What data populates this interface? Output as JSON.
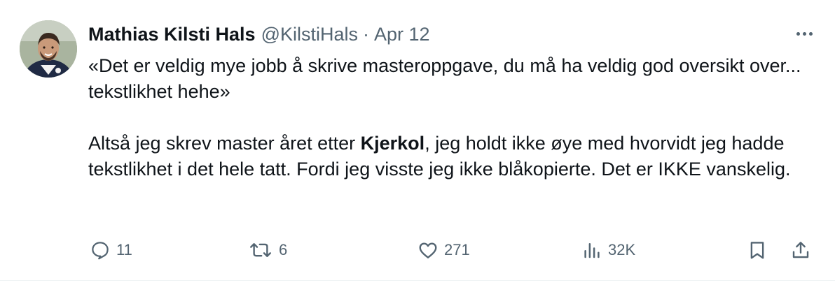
{
  "author": {
    "display_name": "Mathias Kilsti Hals",
    "handle": "@KilstiHals",
    "separator": "·",
    "date": "Apr 12"
  },
  "tweet": {
    "line1": "«Det er veldig mye jobb å skrive masteroppgave, du må ha veldig god oversikt over... tekstlikhet hehe»",
    "para2_before": "Altså jeg skrev master året etter ",
    "para2_bold": "Kjerkol",
    "para2_after": ", jeg holdt ikke øye med hvorvidt jeg hadde tekstlikhet i det hele tatt. Fordi jeg visste jeg ikke blåkopierte. Det er IKKE vanskelig."
  },
  "actions": {
    "replies": "11",
    "retweets": "6",
    "likes": "271",
    "views": "32K"
  },
  "icons": {
    "avatar": "profile-photo",
    "more": "more-dots-icon",
    "reply": "reply-icon",
    "retweet": "retweet-icon",
    "like": "heart-icon",
    "views": "views-chart-icon",
    "bookmark": "bookmark-icon",
    "share": "share-icon"
  },
  "colors": {
    "text": "#0f1419",
    "secondary": "#536471",
    "divider": "#eff3f4"
  }
}
